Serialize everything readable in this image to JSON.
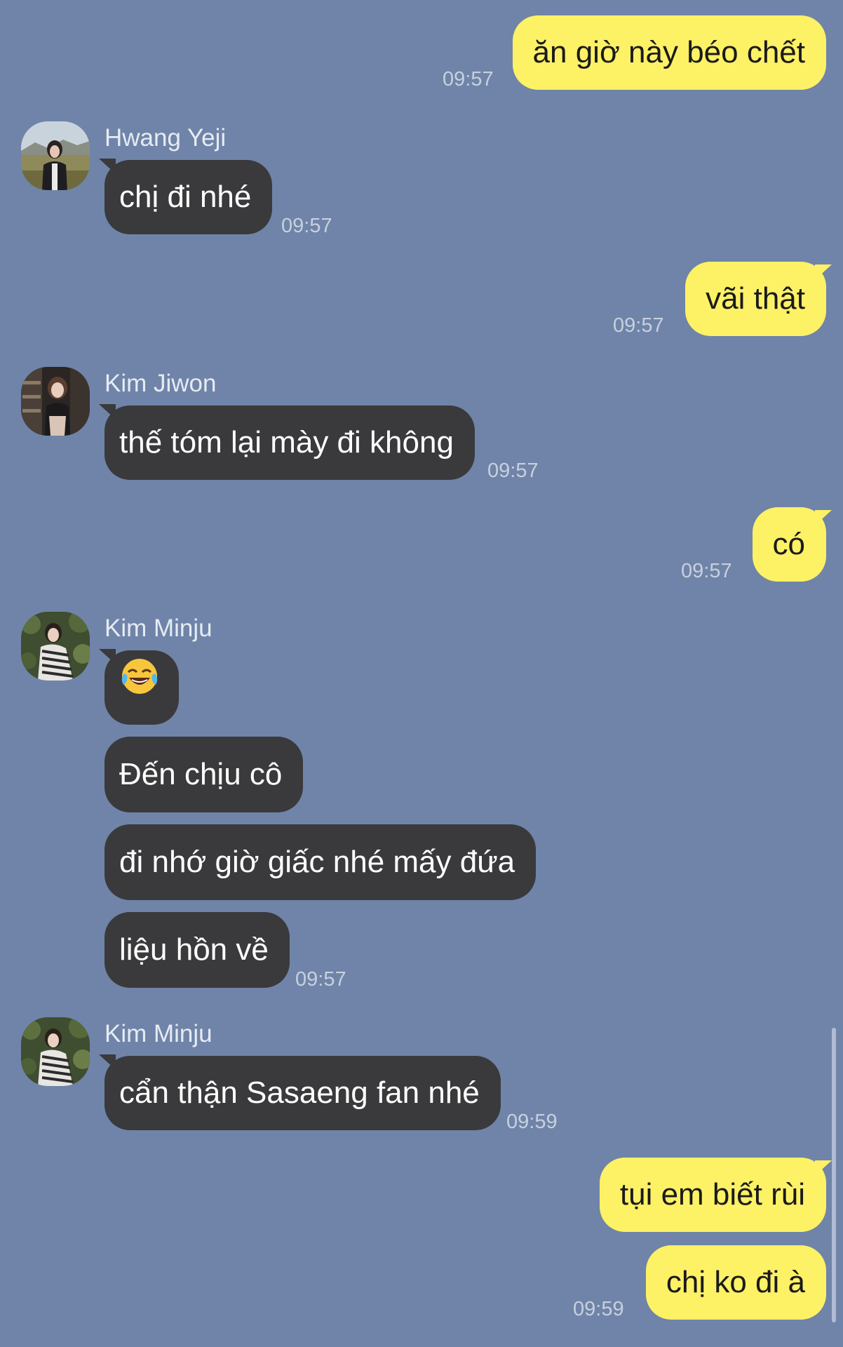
{
  "messages": [
    {
      "id": "m1",
      "direction": "out",
      "text": "ăn giờ này béo chết",
      "time": "09:57"
    },
    {
      "id": "m2",
      "direction": "in",
      "sender": "Hwang Yeji",
      "text": "chị đi nhé",
      "time": "09:57"
    },
    {
      "id": "m3",
      "direction": "out",
      "text": "vãi thật",
      "time": "09:57"
    },
    {
      "id": "m4",
      "direction": "in",
      "sender": "Kim Jiwon",
      "text": "thế tóm lại mày đi không",
      "time": "09:57"
    },
    {
      "id": "m5",
      "direction": "out",
      "text": "có",
      "time": "09:57"
    },
    {
      "id": "m6",
      "direction": "in",
      "sender": "Kim Minju",
      "emoji": "face-with-tears-of-joy-icon"
    },
    {
      "id": "m7",
      "direction": "in",
      "text": "Đến chịu cô"
    },
    {
      "id": "m8",
      "direction": "in",
      "text": "đi nhớ giờ giấc nhé mấy đứa"
    },
    {
      "id": "m9",
      "direction": "in",
      "text": "liệu hồn về",
      "time": "09:57"
    },
    {
      "id": "m10",
      "direction": "in",
      "sender": "Kim Minju",
      "text": "cẩn thận Sasaeng fan nhé",
      "time": "09:59"
    },
    {
      "id": "m11",
      "direction": "out",
      "text": "tụi em biết rùi"
    },
    {
      "id": "m12",
      "direction": "out",
      "text": "chị ko đi à",
      "time": "09:59"
    }
  ],
  "colors": {
    "background": "#6f84a8",
    "incoming_bubble": "#3a3a3c",
    "outgoing_bubble": "#fdf165",
    "timestamp": "#c7d0de"
  }
}
